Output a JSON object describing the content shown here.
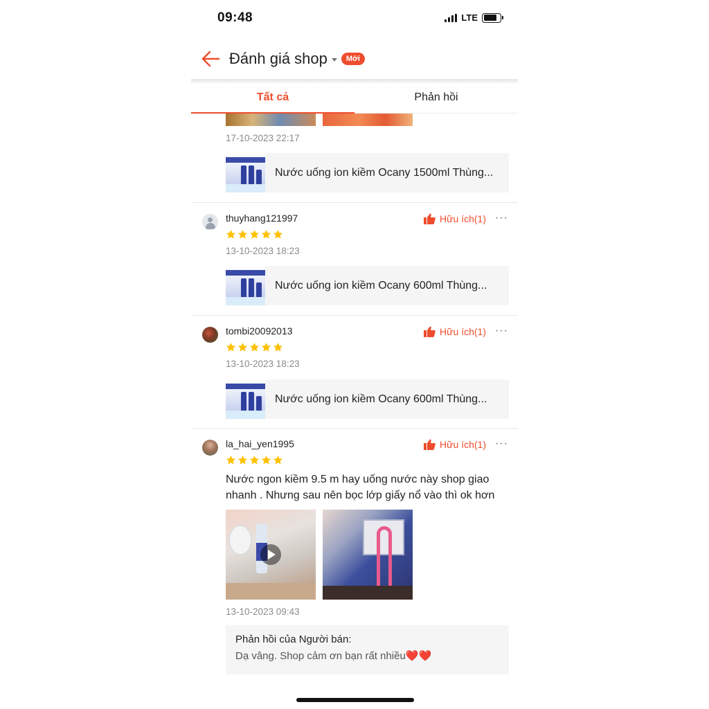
{
  "status_bar": {
    "time": "09:48",
    "network": "LTE"
  },
  "header": {
    "title": "Đánh giá shop",
    "badge": "Mới"
  },
  "tabs": [
    {
      "label": "Tất cả",
      "active": true
    },
    {
      "label": "Phản hồi",
      "active": false
    }
  ],
  "colors": {
    "accent": "#ee4d2d",
    "star": "#ffc107"
  },
  "reviews": [
    {
      "date": "17-10-2023 22:17",
      "product": "Nước uống ion kiềm Ocany 1500ml Thùng..."
    },
    {
      "username": "thuyhang121997",
      "rating": 5,
      "helpful": "Hữu ích(1)",
      "date": "13-10-2023 18:23",
      "product": "Nước uống ion kiềm Ocany 600ml Thùng..."
    },
    {
      "username": "tombi20092013",
      "rating": 5,
      "helpful": "Hữu ích(1)",
      "date": "13-10-2023 18:23",
      "product": "Nước uống ion kiềm Ocany 600ml Thùng..."
    },
    {
      "username": "la_hai_yen1995",
      "rating": 5,
      "helpful": "Hữu ích(1)",
      "text": "Nước ngon kiềm 9.5 m hay uống nước này shop giao nhanh . Nhưng sau nên bọc lớp giấy nổ vào thì ok hơn",
      "date": "13-10-2023 09:43",
      "seller_reply": {
        "label": "Phản hồi của Người bán:",
        "text": "Dạ vâng. Shop cảm ơn bạn rất nhiều❤️❤️"
      }
    }
  ]
}
